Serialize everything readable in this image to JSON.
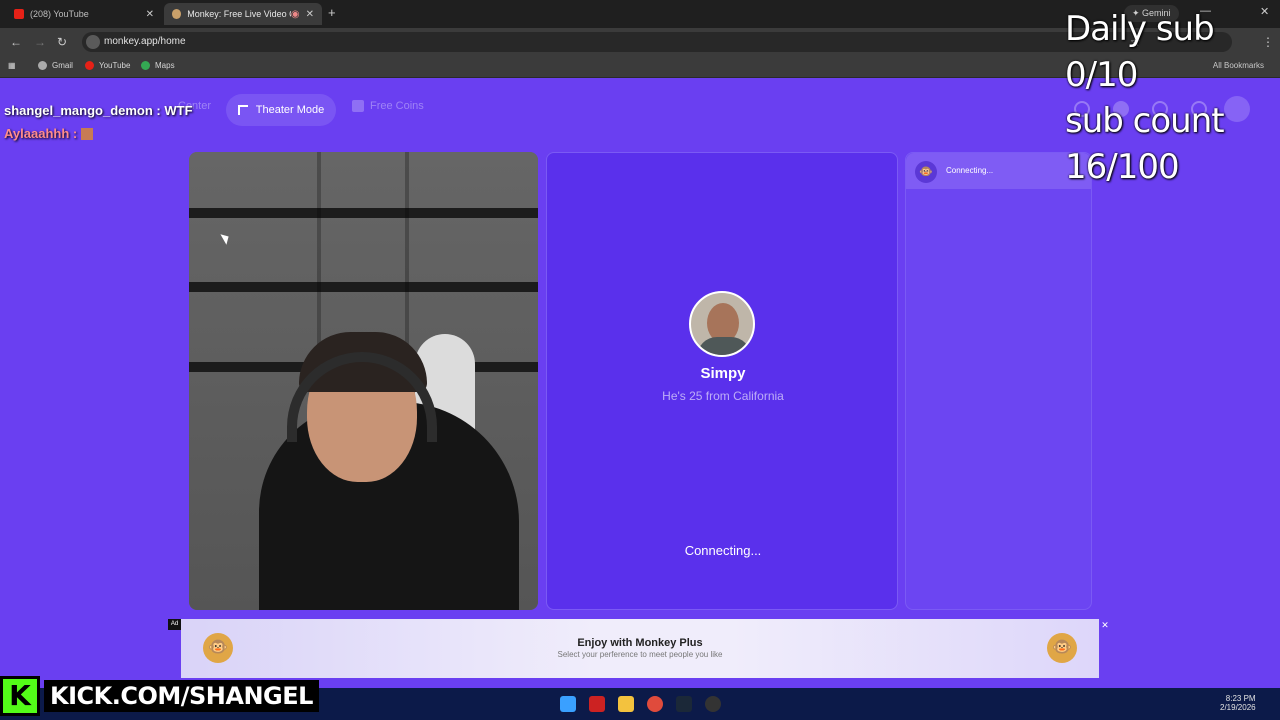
{
  "browser": {
    "tabs": [
      {
        "title": "(208) YouTube"
      },
      {
        "title": "Monkey: Free Live Video Cl"
      }
    ],
    "gemini_label": "Gemini",
    "url": "monkey.app/home",
    "bookmarks": [
      "Gmail",
      "YouTube",
      "Maps"
    ],
    "all_bookmarks_label": "All Bookmarks"
  },
  "monkey": {
    "nav": {
      "center_label": "Center",
      "theater_label": "Theater Mode",
      "coins_label": "Free Coins"
    },
    "match": {
      "name": "Simpy",
      "subtitle": "He's 25 from California",
      "status": "Connecting..."
    },
    "chat": {
      "status": "Connecting..."
    },
    "ad": {
      "tag": "Ad",
      "title": "Enjoy with Monkey Plus",
      "subtitle": "Select your perference to meet people you like"
    }
  },
  "overlay": {
    "chat_lines": [
      {
        "text": "shangel_mango_demon : WTF"
      },
      {
        "text": "Aylaaahhh :"
      }
    ],
    "daily_sub": "Daily sub 0/10",
    "sub_count": "sub count 16/100",
    "kick_url": "KICK.COM/SHANGEL",
    "kick_logo": "K"
  },
  "taskbar": {
    "time": "8:23 PM",
    "date": "2/19/2026"
  }
}
